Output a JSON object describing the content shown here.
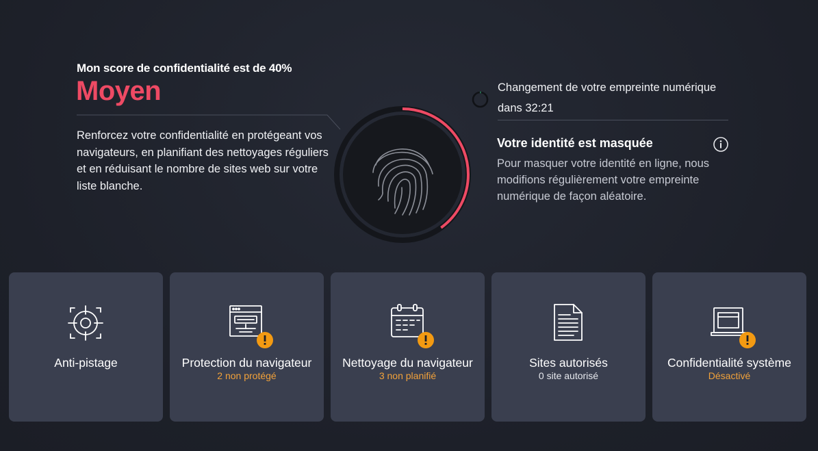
{
  "score": {
    "subtitle": "Mon score de confidentialité est de 40%",
    "level": "Moyen",
    "level_color": "#ee4a64",
    "percent": 40,
    "description": "Renforcez votre confidentialité en protégeant vos navigateurs, en planifiant des nettoyages réguliers et en réduisant le nombre de sites web sur votre liste blanche."
  },
  "fingerprint": {
    "icon": "fingerprint-icon",
    "change_label": "Changement de votre empreinte numérique",
    "countdown": "dans 32:21",
    "identity_title": "Votre identité est masquée",
    "identity_description": "Pour masquer votre identité en ligne, nous modifions régulièrement votre empreinte numérique de façon aléatoire."
  },
  "colors": {
    "accent_red": "#ee4a64",
    "warning_orange": "#f2a23a",
    "card_bg": "#3a3f4f"
  },
  "cards": [
    {
      "label": "Anti-pistage",
      "status": "",
      "icon": "crosshair-icon",
      "warning": false
    },
    {
      "label": "Protection du navigateur",
      "status": "2 non protégé",
      "icon": "browser-icon",
      "warning": true
    },
    {
      "label": "Nettoyage du navigateur",
      "status": "3 non planifié",
      "icon": "calendar-icon",
      "warning": true
    },
    {
      "label": "Sites autorisés",
      "status": "0 site autorisé",
      "icon": "document-icon",
      "warning": false
    },
    {
      "label": "Confidentialité système",
      "status": "Désactivé",
      "icon": "laptop-icon",
      "warning": true
    }
  ]
}
